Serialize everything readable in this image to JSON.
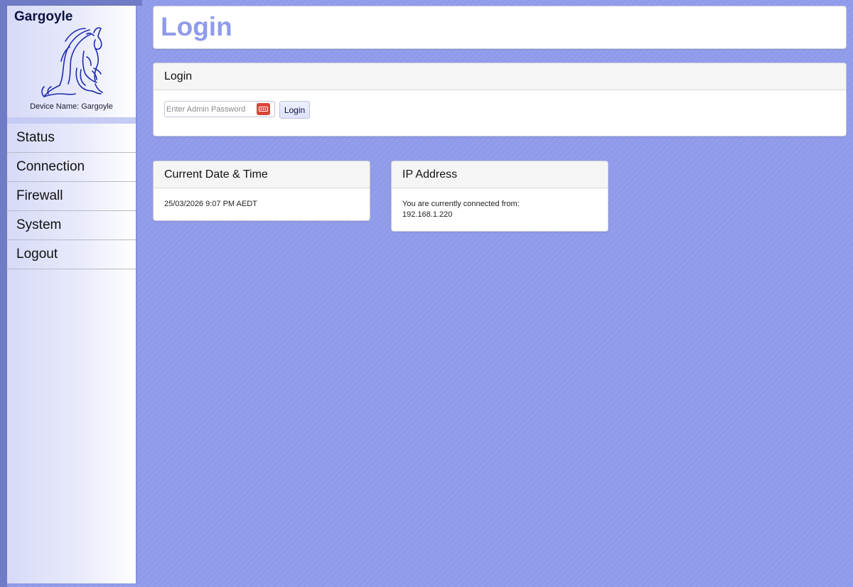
{
  "app": {
    "brand": "Gargoyle",
    "device_name_label": "Device Name: Gargoyle",
    "logo_icon": "gargoyle-logo"
  },
  "sidebar": {
    "items": [
      {
        "label": "Status"
      },
      {
        "label": "Connection"
      },
      {
        "label": "Firewall"
      },
      {
        "label": "System"
      },
      {
        "label": "Logout"
      }
    ]
  },
  "page": {
    "title": "Login"
  },
  "login_panel": {
    "header": "Login",
    "password_placeholder": "Enter Admin Password",
    "password_value": "",
    "password_manager_icon": "password-key-icon",
    "button_label": "Login"
  },
  "datetime_panel": {
    "header": "Current Date & Time",
    "value": "25/03/2026 9:07 PM AEDT"
  },
  "ip_panel": {
    "header": "IP Address",
    "line1": "You are currently connected from:",
    "ip": "192.168.1.220"
  },
  "colors": {
    "background": "#8f9bea",
    "title_accent": "#8f9bea",
    "brand_text": "#0d1140",
    "key_icon": "#d9463a"
  }
}
